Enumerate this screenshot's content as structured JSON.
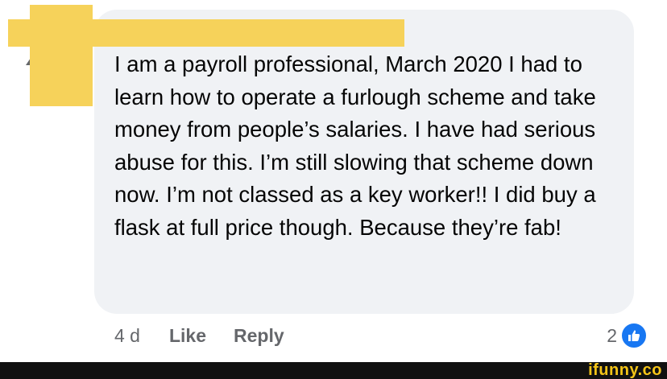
{
  "comment": {
    "text": "I am a payroll professional, March 2020 I had to learn how to operate a furlough scheme and take money from people’s salaries. I have had serious abuse for this. I’m still slowing that scheme down now. I’m not classed as a key worker!! I did buy a flask at full price though. Because they’re fab!"
  },
  "actions": {
    "timestamp": "4 d",
    "like_label": "Like",
    "reply_label": "Reply"
  },
  "reactions": {
    "count": "2",
    "icon": "thumbs-up-icon"
  },
  "footer": {
    "watermark": "ifunny.co"
  },
  "colors": {
    "redaction": "#f6d25a",
    "bubble": "#f0f2f5",
    "like_blue": "#1877f2",
    "watermark": "#f5c518"
  }
}
